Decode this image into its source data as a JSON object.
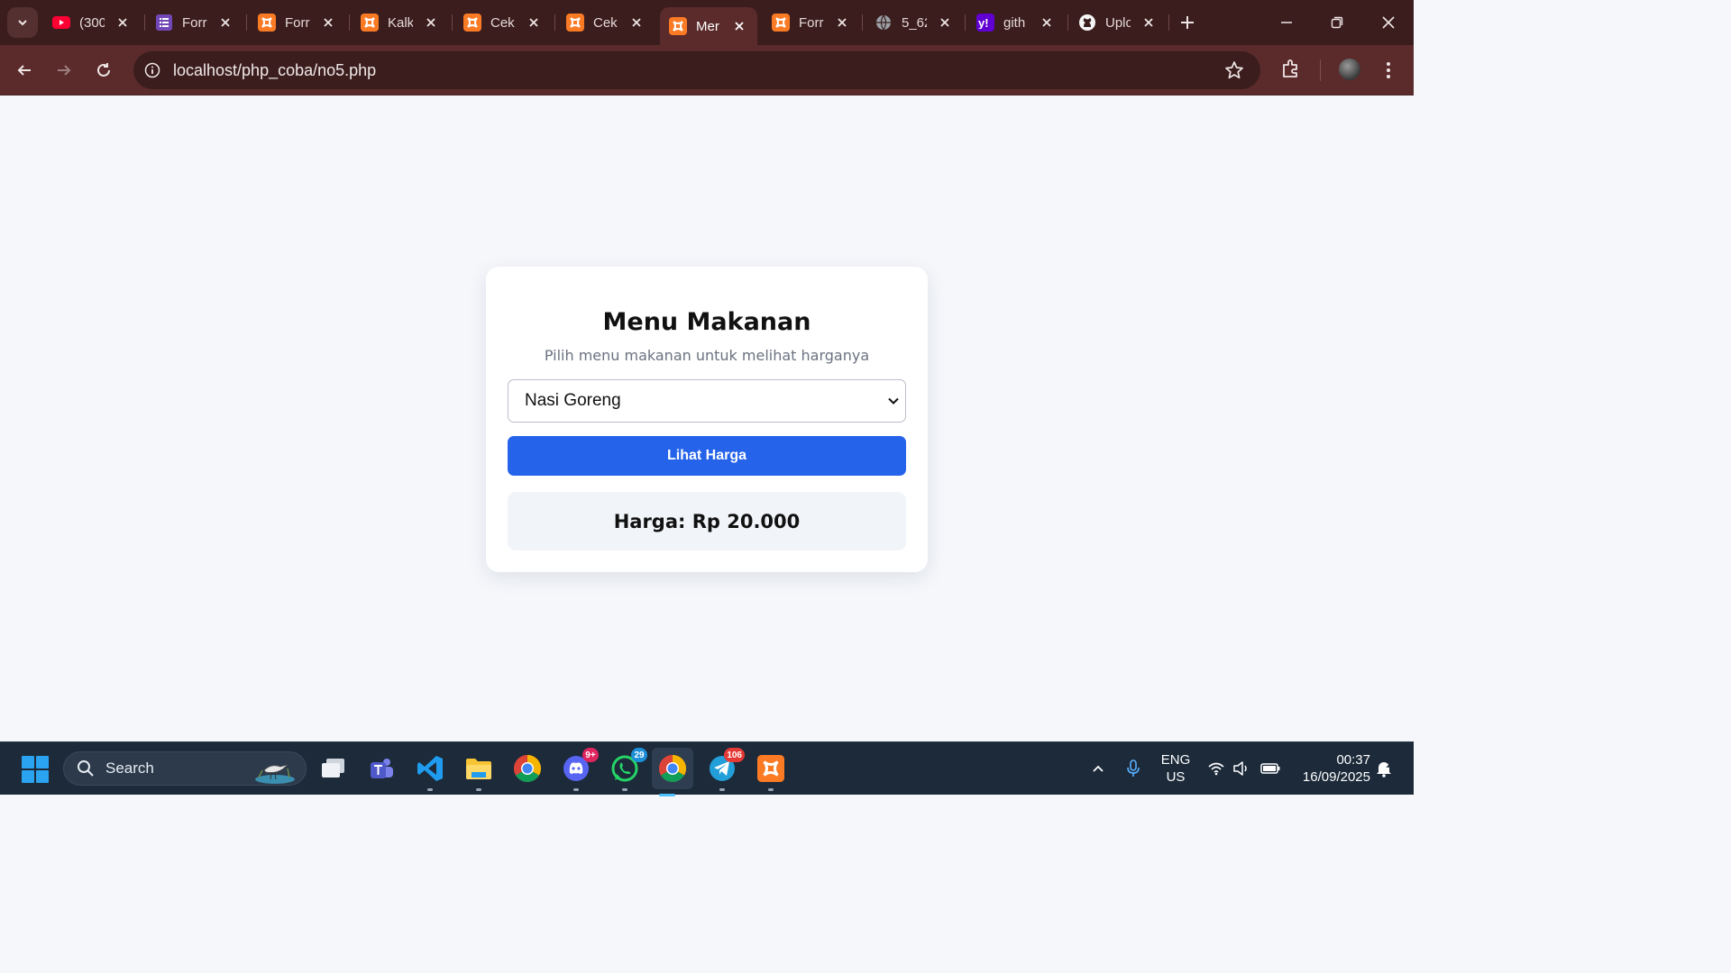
{
  "browser": {
    "tabs": [
      {
        "title": "(300",
        "icon": "youtube-icon"
      },
      {
        "title": "Forr",
        "icon": "google-forms-icon"
      },
      {
        "title": "Forr",
        "icon": "xampp-icon"
      },
      {
        "title": "Kalk",
        "icon": "xampp-icon"
      },
      {
        "title": "Cek",
        "icon": "xampp-icon"
      },
      {
        "title": "Cek",
        "icon": "xampp-icon"
      },
      {
        "title": "Mer",
        "icon": "xampp-icon",
        "active": true
      },
      {
        "title": "Forr",
        "icon": "xampp-icon"
      },
      {
        "title": "5_62",
        "icon": "globe-icon"
      },
      {
        "title": "gith",
        "icon": "yahoo-icon"
      },
      {
        "title": "Uplo",
        "icon": "github-icon"
      }
    ],
    "url": "localhost/php_coba/no5.php"
  },
  "page": {
    "title": "Menu Makanan",
    "subtitle": "Pilih menu makanan untuk melihat harganya",
    "select_value": "Nasi Goreng",
    "button_label": "Lihat Harga",
    "result": "Harga: Rp 20.000"
  },
  "taskbar": {
    "search_label": "Search",
    "discord_badge": "9+",
    "whatsapp_badge": "29",
    "telegram_badge": "106",
    "lang_top": "ENG",
    "lang_bottom": "US",
    "time": "00:37",
    "date": "16/09/2025"
  },
  "colors": {
    "accent": "#2563eb",
    "browser_frame": "#3b1d1d",
    "toolbar": "#5b2b2b",
    "taskbar": "#1c2a3a"
  }
}
